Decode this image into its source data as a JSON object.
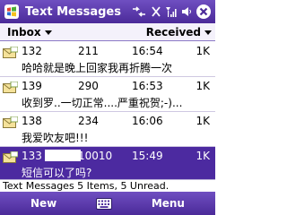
{
  "window": {
    "title": "Text Messages",
    "close_label": "ok"
  },
  "header": {
    "folder": "Inbox",
    "sort": "Received"
  },
  "messages": [
    {
      "from": "132",
      "tail": "211",
      "time": "16:54",
      "size": "1K",
      "preview": "哈哈就是晚上回家我再折腾一次",
      "icon": "envelope-icon"
    },
    {
      "from": "139",
      "tail": "290",
      "time": "16:53",
      "size": "1K",
      "preview": "收到罗..一切正常....严重祝贺;-)...",
      "icon": "envelope-icon"
    },
    {
      "from": "138",
      "tail": "234",
      "time": "16:06",
      "size": "1K",
      "preview": "我爱吹友吧!!!",
      "icon": "envelope-icon"
    },
    {
      "from": "133",
      "tail": "10010",
      "time": "15:49",
      "size": "1K",
      "preview": "短信可以了吗?",
      "icon": "envelope-icon"
    }
  ],
  "status": {
    "text": "Text Messages  5 Items, 5 Unread."
  },
  "softkeys": {
    "left": "New",
    "right": "Menu"
  },
  "colors": {
    "accent": "#4c2aa0",
    "title_bar": "#5a38ad"
  }
}
